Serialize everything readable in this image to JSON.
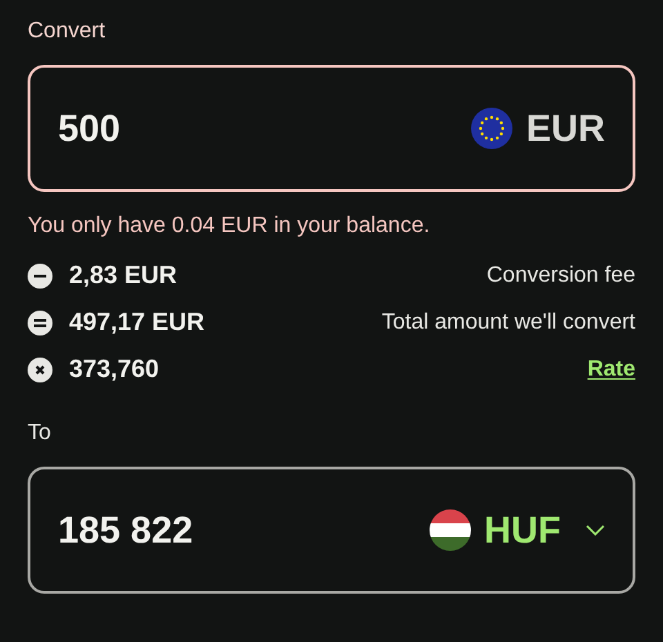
{
  "from": {
    "label": "Convert",
    "amount": "500",
    "currency": "EUR",
    "flag": {
      "kind": "eu"
    },
    "error": true,
    "selectable": false,
    "message": "You only have 0.04 EUR in your balance."
  },
  "fees": [
    {
      "kind": "minus",
      "value": "2,83 EUR",
      "label": "Conversion fee",
      "link": false
    },
    {
      "kind": "equals",
      "value": "497,17 EUR",
      "label": "Total amount we'll convert",
      "link": false
    },
    {
      "kind": "times",
      "value": "373,760",
      "label": "Rate",
      "link": true
    }
  ],
  "to": {
    "label": "To",
    "amount": "185 822",
    "currency": "HUF",
    "flag": {
      "kind": "hu"
    },
    "error": false,
    "selectable": true
  }
}
